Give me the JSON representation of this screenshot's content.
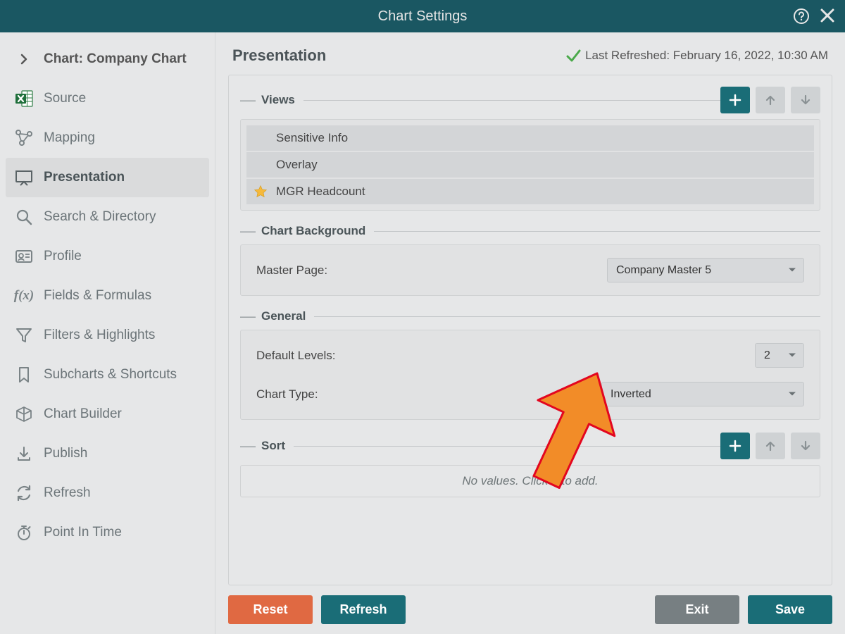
{
  "title": "Chart Settings",
  "sidebar": {
    "top": "Chart: Company Chart",
    "items": [
      "Source",
      "Mapping",
      "Presentation",
      "Search & Directory",
      "Profile",
      "Fields & Formulas",
      "Filters & Highlights",
      "Subcharts & Shortcuts",
      "Chart Builder",
      "Publish",
      "Refresh",
      "Point In Time"
    ]
  },
  "main": {
    "title": "Presentation",
    "refreshed": "Last Refreshed: February 16, 2022, 10:30 AM"
  },
  "views": {
    "title": "Views",
    "items": [
      "Sensitive Info",
      "Overlay",
      "MGR Headcount"
    ]
  },
  "chart_bg": {
    "title": "Chart Background",
    "master_label": "Master Page:",
    "master_value": "Company Master 5"
  },
  "general": {
    "title": "General",
    "levels_label": "Default Levels:",
    "levels_value": "2",
    "type_label": "Chart Type:",
    "type_value": "Inverted"
  },
  "sort": {
    "title": "Sort",
    "empty": "No values. Click + to add."
  },
  "footer": {
    "reset": "Reset",
    "refresh": "Refresh",
    "exit": "Exit",
    "save": "Save"
  }
}
